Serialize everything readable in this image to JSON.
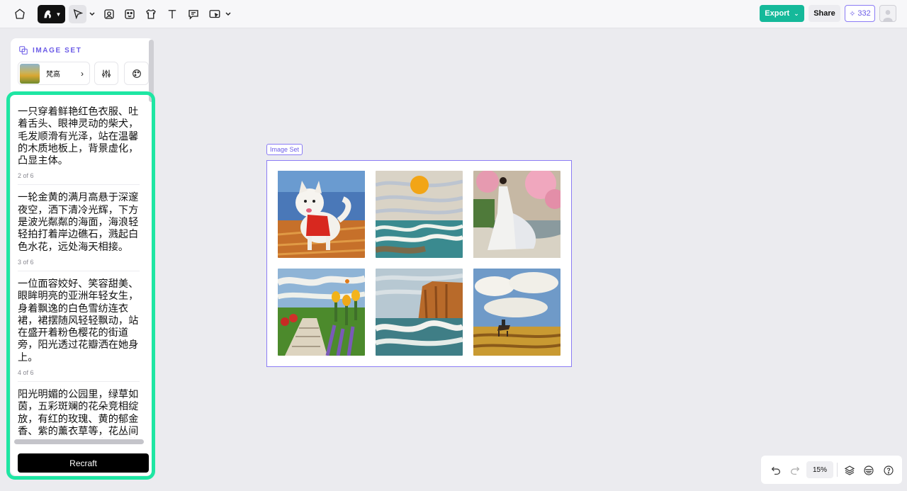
{
  "toolbar": {
    "tools": [
      "home-icon",
      "brand-style-icon",
      "select-icon",
      "image-icon",
      "sticker-icon",
      "mockup-icon",
      "text-icon",
      "comment-icon",
      "generate-icon"
    ],
    "export_label": "Export",
    "share_label": "Share",
    "credits": "332"
  },
  "panel": {
    "header": "IMAGE SET",
    "style_name": "梵高",
    "prompts": [
      {
        "text": "一只穿着鲜艳红色衣服、吐着舌头、眼神灵动的柴犬，毛发顺滑有光泽，站在温馨的木质地板上，背景虚化，凸显主体。",
        "count": "2 of 6"
      },
      {
        "text": "一轮金黄的满月高悬于深邃夜空，洒下清冷光辉，下方是波光粼粼的海面，海浪轻轻拍打着岸边礁石，溅起白色水花，远处海天相接。",
        "count": "3 of 6"
      },
      {
        "text": "一位面容姣好、笑容甜美、眼眸明亮的亚洲年轻女生，身着飘逸的白色雪纺连衣裙，裙摆随风轻轻飘动，站在盛开着粉色樱花的街道旁，阳光透过花瓣洒在她身上。",
        "count": "4 of 6"
      },
      {
        "text": "阳光明媚的公园里，绿草如茵，五彩斑斓的花朵竞相绽放，有红的玫瑰、黄的郁金香、紫的薰衣草等，花丛间蝴蝶翩翩起舞，一条蜿蜒的",
        "count": ""
      }
    ],
    "recraft_label": "Recraft"
  },
  "canvas": {
    "set_tag": "Image Set",
    "images": [
      "shiba-dog-image",
      "moon-sea-image",
      "girl-cherry-blossom-image",
      "flower-park-image",
      "cliff-waves-image",
      "horse-rider-field-image"
    ]
  },
  "bottom": {
    "zoom": "15%"
  },
  "colors": {
    "accent": "#6c5ce7",
    "export": "#15b99a",
    "panel_outline": "#1ee6a3"
  }
}
